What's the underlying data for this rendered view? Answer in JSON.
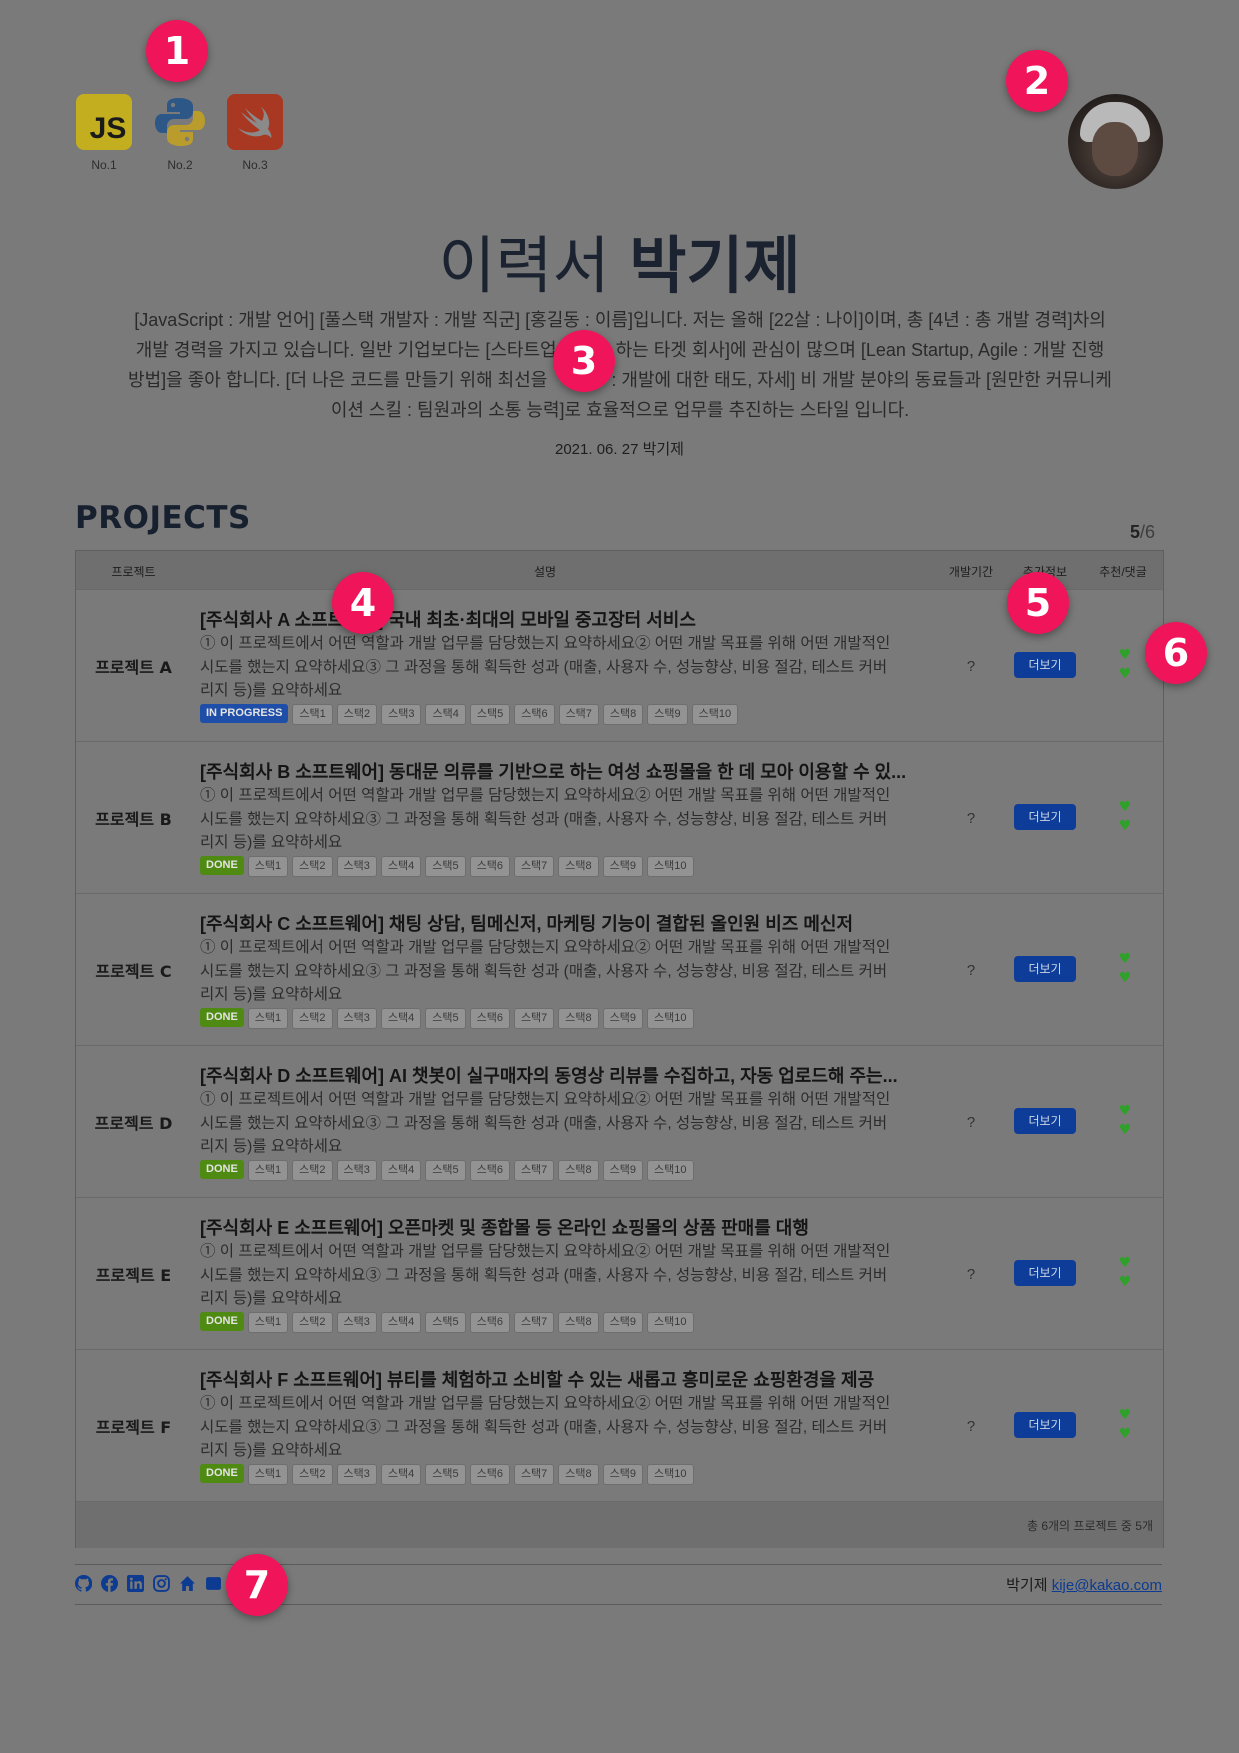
{
  "markers": [
    "1",
    "2",
    "3",
    "4",
    "5",
    "6",
    "7"
  ],
  "languages": [
    {
      "name": "JavaScript",
      "icon": "javascript-icon",
      "text": "JS",
      "caption": "No.1"
    },
    {
      "name": "Python",
      "icon": "python-icon",
      "caption": "No.2"
    },
    {
      "name": "Swift",
      "icon": "swift-icon",
      "caption": "No.3"
    }
  ],
  "header": {
    "title_prefix": "이력서",
    "title_name": "박기제"
  },
  "intro": {
    "parts": [
      "[JavaScript : 개발 언어] [풀스택 개발자 : 개발 직군] [홍길동 : 이름]입니다. 저는 올해 [22살 : 나이]이며, 총 [4년 : 총 개발 경력]차의 개발 경력을 가지고 있습니다. 일반 기업보다는 [스타트업 ",
      "하는 타겟 회사]에 관심이 많으며 [Lean Startup, Agile : 개발 진행 방법]을 좋아 합니다. [더 나은 코드를 만들기 위해 최선을 ",
      " : 개발에 대한 태도, 자세] 비 개발 분야의 동료들과 [원만한 커뮤니케이션 스킬 : 팀원과의 소통 능력]로 효율적으로 업무를 추진하는 스타일 입니다."
    ],
    "date": "2021. 06. 27 박기제"
  },
  "projects": {
    "title": "PROJECTS",
    "page_current": "5",
    "page_total": "/6",
    "columns": {
      "project": "프로젝트",
      "description": "설명",
      "period": "개발기간",
      "extra": "추가정보",
      "likes": "추천/댓글"
    },
    "rows": [
      {
        "name": "프로젝트 A",
        "heading": "[주식회사 A 소프트웨어] 국내 최초·최대의 모바일 중고장터 서비스",
        "status": "IN PROGRESS",
        "status_type": "progress",
        "period": "?",
        "more": "더보기"
      },
      {
        "name": "프로젝트 B",
        "heading": "[주식회사 B 소프트웨어] 동대문 의류를 기반으로 하는 여성 쇼핑몰을 한 데 모아 이용할 수 있...",
        "status": "DONE",
        "status_type": "done",
        "period": "?",
        "more": "더보기"
      },
      {
        "name": "프로젝트 C",
        "heading": "[주식회사 C 소프트웨어] 채팅 상담, 팀메신저, 마케팅 기능이 결합된 올인원 비즈 메신저",
        "status": "DONE",
        "status_type": "done",
        "period": "?",
        "more": "더보기"
      },
      {
        "name": "프로젝트 D",
        "heading": "[주식회사 D 소프트웨어] AI 챗봇이 실구매자의 동영상 리뷰를 수집하고, 자동 업로드해 주는...",
        "status": "DONE",
        "status_type": "done",
        "period": "?",
        "more": "더보기"
      },
      {
        "name": "프로젝트 E",
        "heading": "[주식회사 E 소프트웨어] 오픈마켓 및 종합몰 등 온라인 쇼핑몰의 상품 판매를 대행",
        "status": "DONE",
        "status_type": "done",
        "period": "?",
        "more": "더보기"
      },
      {
        "name": "프로젝트 F",
        "heading": "[주식회사 F 소프트웨어] 뷰티를 체험하고 소비할 수 있는 새롭고 흥미로운 쇼핑환경을 제공",
        "status": "DONE",
        "status_type": "done",
        "period": "?",
        "more": "더보기"
      }
    ],
    "description": "① 이 프로젝트에서 어떤 역할과 개발 업무를 담당했는지 요약하세요② 어떤 개발 목표를 위해 어떤 개발적인 시도를 했는지 요약하세요③ 그 과정을 통해 획득한 성과 (매출, 사용자 수, 성능향상, 비용 절감, 테스트 커버리지 등)를 요약하세요",
    "stacks": [
      "스택1",
      "스택2",
      "스택3",
      "스택4",
      "스택5",
      "스택6",
      "스택7",
      "스택8",
      "스택9",
      "스택10"
    ],
    "summary": "총 6개의 프로젝트 중 5개",
    "heart_icon": "heart-icon",
    "heart_color": "#2fa12b"
  },
  "footer": {
    "social_icons": [
      "github-icon",
      "facebook-icon",
      "linkedin-icon",
      "instagram-icon",
      "home-icon",
      "blog-icon"
    ],
    "name": "박기제",
    "email": "kije@kakao.com"
  },
  "colors": {
    "marker": "#f0145a",
    "more_button": "#0d3d99",
    "in_progress": "#1f4ea8",
    "done": "#4f8a12",
    "email_link": "#0d3b91"
  }
}
